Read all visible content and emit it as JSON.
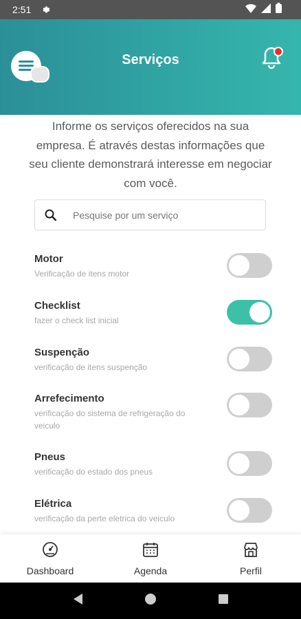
{
  "status_bar": {
    "time": "2:51"
  },
  "header": {
    "title": "Serviços"
  },
  "intro": "Informe os serviços oferecidos na sua empresa. É através destas informações que seu cliente demonstrará interesse em negociar com você.",
  "search": {
    "placeholder": "Pesquise por um serviço"
  },
  "services": [
    {
      "name": "Motor",
      "description": "Verificação de itens motor",
      "enabled": false
    },
    {
      "name": "Checklist",
      "description": "fazer o check list inicial",
      "enabled": true
    },
    {
      "name": "Suspenção",
      "description": "verificação de itens suspenção",
      "enabled": false
    },
    {
      "name": "Arrefecimento",
      "description": "verificação do sistema de refrigeração do veiculo",
      "enabled": false
    },
    {
      "name": "Pneus",
      "description": "verificação do estado dos pneus",
      "enabled": false
    },
    {
      "name": "Elétrica",
      "description": "verificação da perte eletrica do veiculo",
      "enabled": false
    }
  ],
  "bottom_nav": [
    {
      "label": "Dashboard",
      "icon": "dashboard-icon"
    },
    {
      "label": "Agenda",
      "icon": "calendar-icon"
    },
    {
      "label": "Perfil",
      "icon": "store-icon"
    }
  ],
  "colors": {
    "header_start": "#2b8f98",
    "header_end": "#35b6ad",
    "toggle_on": "#3cc1a8",
    "notification_dot": "#e2322b"
  }
}
